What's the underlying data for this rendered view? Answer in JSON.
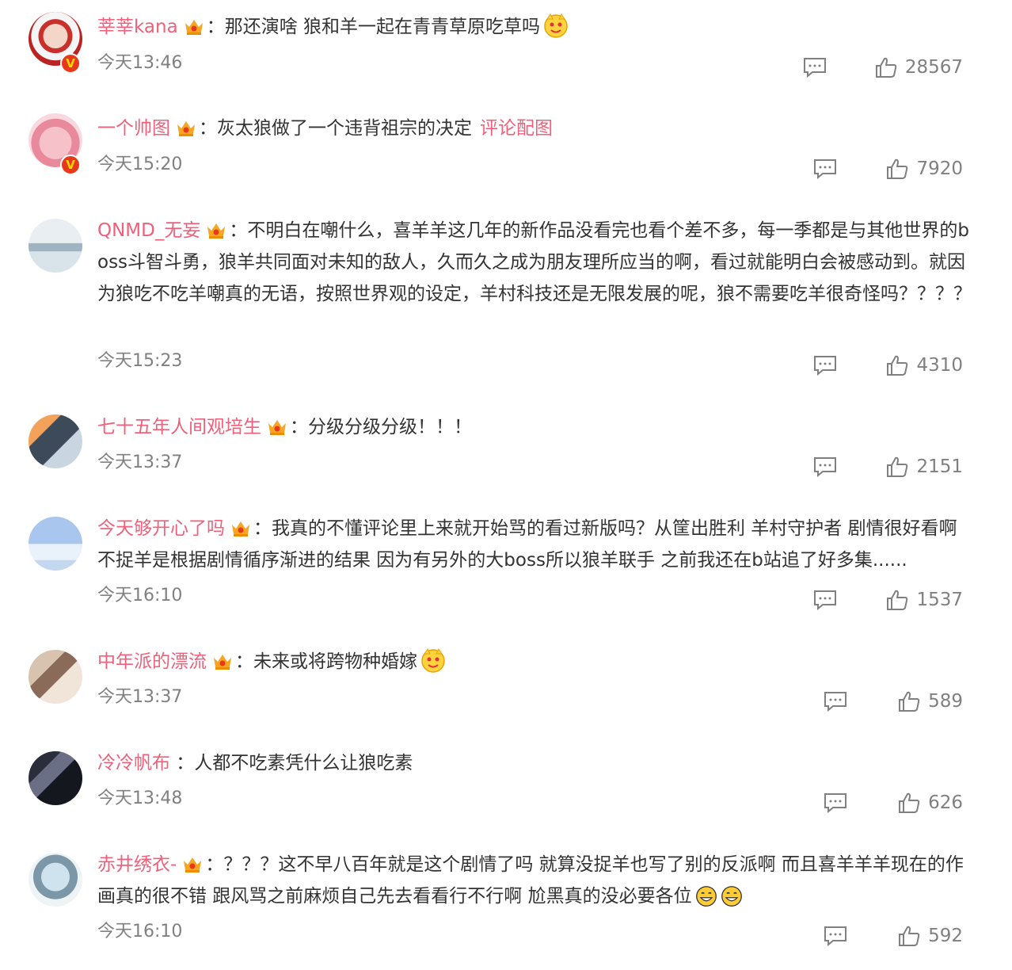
{
  "comments": [
    {
      "user": "莘莘kana",
      "text": "那还演啥 狼和羊一起在青青草原吃草吗",
      "time": "今天13:46",
      "likes": "28567",
      "verified": true,
      "emoji": true
    },
    {
      "user": "一个帅图",
      "text": "灰太狼做了一个违背祖宗的决定",
      "tag": "评论配图",
      "time": "今天15:20",
      "likes": "7920",
      "verified": true
    },
    {
      "user": "QNMD_无妄",
      "text": "不明白在嘲什么，喜羊羊这几年的新作品没看完也看个差不多，每一季都是与其他世界的boss斗智斗勇，狼羊共同面对未知的敌人，久而久之成为朋友理所应当的啊，看过就能明白会被感动到。就因为狼吃不吃羊嘲真的无语，按照世界观的设定，羊村科技还是无限发展的呢，狼不需要吃羊很奇怪吗？？？？",
      "time": "今天15:23",
      "likes": "4310"
    },
    {
      "user": "七十五年人间观培生",
      "text": "分级分级分级！！！",
      "time": "今天13:37",
      "likes": "2151"
    },
    {
      "user": "今天够开心了吗",
      "text": "我真的不懂评论里上来就开始骂的看过新版吗？从筐出胜利 羊村守护者 剧情很好看啊 不捉羊是根据剧情循序渐进的结果 因为有另外的大boss所以狼羊联手 之前我还在b站追了好多集......",
      "time": "今天16:10",
      "likes": "1537"
    },
    {
      "user": "中年派的漂流",
      "text": "未来或将跨物种婚嫁",
      "time": "今天13:37",
      "likes": "589",
      "emoji": true
    },
    {
      "user": "冷冷帆布",
      "text": "人都不吃素凭什么让狼吃素",
      "time": "今天13:48",
      "likes": "626",
      "nocrown": true
    },
    {
      "user": "赤井绣衣-",
      "text": "？？？这不早八百年就是这个剧情了吗 就算没捉羊也写了别的反派啊 而且喜羊羊羊现在的作画真的很不错 跟风骂之前麻烦自己先去看看行不行啊 尬黑真的没必要各位",
      "time": "今天16:10",
      "likes": "592",
      "grin": true
    }
  ],
  "colors": {
    "username": "#f0607a",
    "text": "#333333",
    "meta": "#808080",
    "badge": "#e8381b"
  },
  "icons": {
    "reply": "comment-icon",
    "like": "thumbs-up-icon",
    "crown": "crown-badge-icon",
    "verified": "verified-v-icon"
  }
}
